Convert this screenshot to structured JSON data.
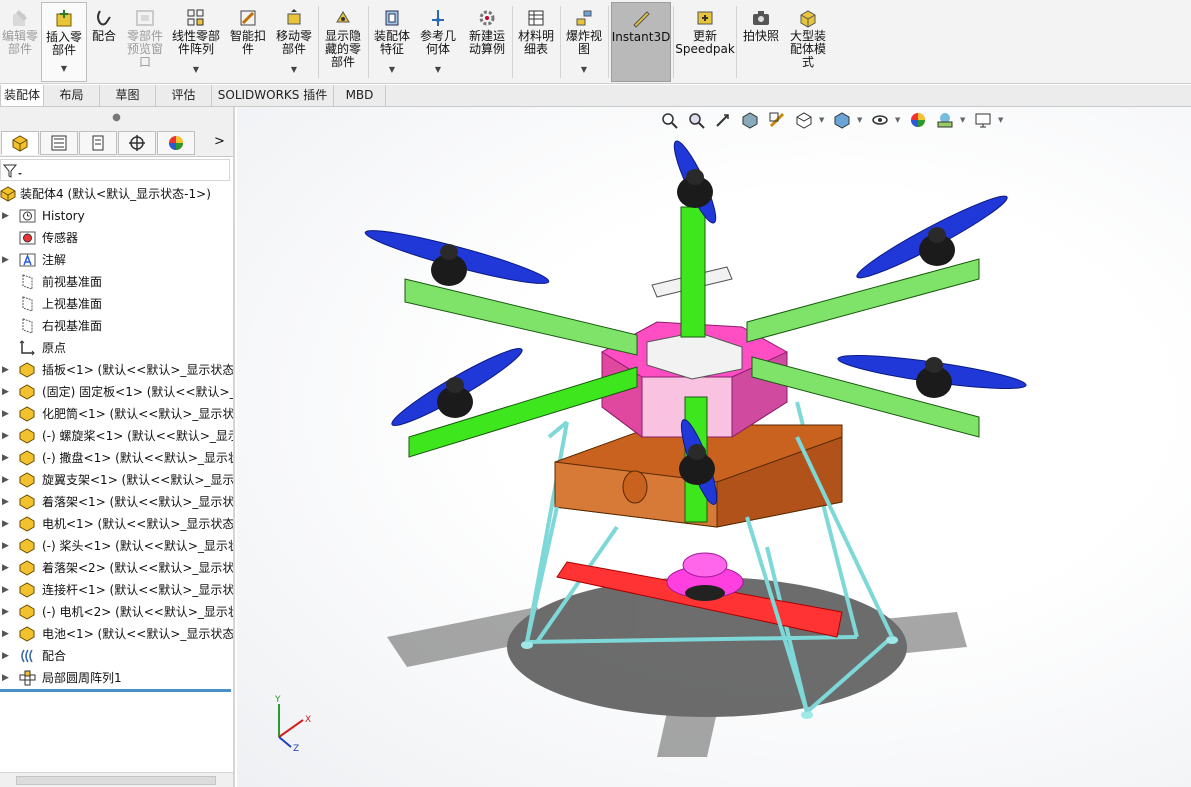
{
  "ribbon": {
    "buttons": [
      {
        "label": "编辑零\n部件",
        "icon": "edit-component-icon",
        "disabled": true
      },
      {
        "label": "插入零\n部件",
        "icon": "insert-components-icon",
        "disabled": false
      },
      {
        "label": "配合",
        "icon": "mate-icon",
        "disabled": false
      },
      {
        "label": "零部件\n预览窗\n口",
        "icon": "component-preview-window-icon",
        "disabled": true
      },
      {
        "label": "线性零部\n件阵列",
        "icon": "linear-component-pattern-icon",
        "disabled": false
      },
      {
        "label": "智能扣\n件",
        "icon": "smart-fasteners-icon",
        "disabled": false
      },
      {
        "label": "移动零\n部件",
        "icon": "move-component-icon",
        "disabled": false
      },
      {
        "label": "显示隐\n藏的零\n部件",
        "icon": "show-hidden-components-icon",
        "disabled": false
      },
      {
        "label": "装配体\n特征",
        "icon": "assembly-features-icon",
        "disabled": false
      },
      {
        "label": "参考几\n何体",
        "icon": "reference-geometry-icon",
        "disabled": false
      },
      {
        "label": "新建运\n动算例",
        "icon": "new-motion-study-icon",
        "disabled": false
      },
      {
        "label": "材料明\n细表",
        "icon": "bill-of-materials-icon",
        "disabled": false
      },
      {
        "label": "爆炸视\n图",
        "icon": "exploded-view-icon",
        "disabled": false
      },
      {
        "label": "Instant3D",
        "icon": "instant3d-icon",
        "disabled": false
      },
      {
        "label": "更新\nSpeedpak",
        "icon": "update-speedpak-icon",
        "disabled": false
      },
      {
        "label": "拍快照",
        "icon": "take-snapshot-icon",
        "disabled": false
      },
      {
        "label": "大型装\n配体模\n式",
        "icon": "large-assembly-mode-icon",
        "disabled": false
      }
    ]
  },
  "command_tabs": [
    "装配体",
    "布局",
    "草图",
    "评估",
    "SOLIDWORKS 插件",
    "MBD"
  ],
  "panel_tabs": [
    "featuremanager-tab-icon",
    "propertymanager-tab-icon",
    "configurationmanager-tab-icon",
    "dimxpertmanager-tab-icon",
    "displaymanager-tab-icon"
  ],
  "panel_more": ">",
  "tree": {
    "root": "装配体4  (默认<默认_显示状态-1>)",
    "items": [
      {
        "label": "History",
        "icon": "history-icon",
        "arrow": "▶"
      },
      {
        "label": "传感器",
        "icon": "sensors-icon",
        "arrow": ""
      },
      {
        "label": "注解",
        "icon": "annotations-icon",
        "arrow": "▶"
      },
      {
        "label": "前视基准面",
        "icon": "plane-icon",
        "arrow": ""
      },
      {
        "label": "上视基准面",
        "icon": "plane-icon",
        "arrow": ""
      },
      {
        "label": "右视基准面",
        "icon": "plane-icon",
        "arrow": ""
      },
      {
        "label": "原点",
        "icon": "origin-icon",
        "arrow": ""
      },
      {
        "label": "插板<1> (默认<<默认>_显示状态",
        "icon": "part-icon",
        "arrow": "▶"
      },
      {
        "label": "(固定) 固定板<1> (默认<<默认>_显",
        "icon": "part-icon",
        "arrow": "▶"
      },
      {
        "label": "化肥筒<1> (默认<<默认>_显示状态",
        "icon": "part-icon",
        "arrow": "▶"
      },
      {
        "label": "(-) 螺旋桨<1> (默认<<默认>_显示",
        "icon": "part-icon",
        "arrow": "▶"
      },
      {
        "label": "(-) 撒盘<1> (默认<<默认>_显示状",
        "icon": "part-icon",
        "arrow": "▶"
      },
      {
        "label": "旋翼支架<1> (默认<<默认>_显示状",
        "icon": "part-icon",
        "arrow": "▶"
      },
      {
        "label": "着落架<1> (默认<<默认>_显示状态",
        "icon": "part-icon",
        "arrow": "▶"
      },
      {
        "label": "电机<1> (默认<<默认>_显示状态",
        "icon": "part-icon",
        "arrow": "▶"
      },
      {
        "label": "(-) 桨头<1> (默认<<默认>_显示状",
        "icon": "part-icon",
        "arrow": "▶"
      },
      {
        "label": "着落架<2> (默认<<默认>_显示状态",
        "icon": "part-icon",
        "arrow": "▶"
      },
      {
        "label": "连接杆<1> (默认<<默认>_显示状态",
        "icon": "part-icon",
        "arrow": "▶"
      },
      {
        "label": "(-) 电机<2> (默认<<默认>_显示状",
        "icon": "part-icon",
        "arrow": "▶"
      },
      {
        "label": "电池<1> (默认<<默认>_显示状态",
        "icon": "part-icon",
        "arrow": "▶"
      },
      {
        "label": "配合",
        "icon": "mates-icon",
        "arrow": "▶"
      },
      {
        "label": "局部圆周阵列1",
        "icon": "circular-pattern-icon",
        "arrow": "▶"
      }
    ]
  },
  "hud_icons": [
    "zoom-to-fit-icon",
    "zoom-to-area-icon",
    "previous-view-icon",
    "section-view-icon",
    "dynamic-annotation-view-icon",
    "view-orientation-icon",
    "display-style-icon",
    "hide-show-items-icon",
    "edit-appearance-icon",
    "apply-scene-icon",
    "view-settings-icon"
  ],
  "triad": {
    "x": "X",
    "y": "Y",
    "z": "Z"
  },
  "colors": {
    "arm": "#3ee61e",
    "arm_light": "#7fe36a",
    "hub_magenta": "#ff4dc4",
    "base_orange": "#c8621e",
    "landing_gear": "#7ed8d8",
    "propeller": "#2038d8",
    "motor": "#1b1b1b",
    "spreader": "#ff3fe0",
    "battery_red": "#ff3333"
  }
}
